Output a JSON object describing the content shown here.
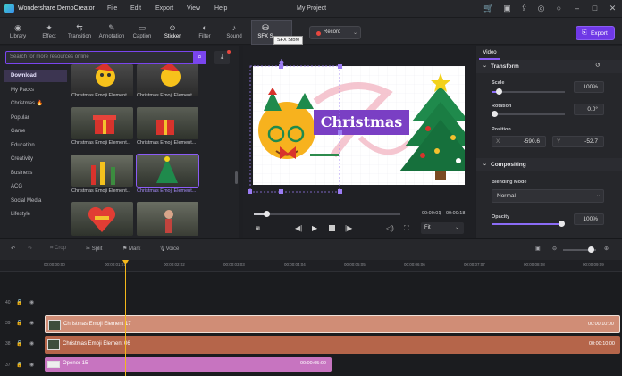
{
  "titlebar": {
    "app_name": "Wondershare DemoCreator",
    "menu": [
      "File",
      "Edit",
      "Export",
      "View",
      "Help"
    ],
    "project_title": "My Project"
  },
  "toolbar": {
    "tools": [
      {
        "label": "Library",
        "icon": "library-icon"
      },
      {
        "label": "Effect",
        "icon": "effect-icon"
      },
      {
        "label": "Transition",
        "icon": "transition-icon"
      },
      {
        "label": "Annotation",
        "icon": "annotation-icon"
      },
      {
        "label": "Caption",
        "icon": "caption-icon"
      },
      {
        "label": "Sticker",
        "icon": "sticker-icon"
      },
      {
        "label": "Filter",
        "icon": "filter-icon"
      },
      {
        "label": "Sound",
        "icon": "sound-icon"
      },
      {
        "label": "SFX S",
        "icon": "sfx-store-icon"
      }
    ],
    "tooltip": "SFX Store",
    "record_label": "Record",
    "export_label": "Export"
  },
  "library": {
    "search_placeholder": "Search for more resources online",
    "categories": [
      "Download",
      "My Packs",
      "Christmas 🔥",
      "Popular",
      "Game",
      "Education",
      "Creativity",
      "Business",
      "ACG",
      "Social Media",
      "Lifestyle"
    ],
    "items": [
      "Christmas Emoji Element...",
      "Christmas Emoji Element...",
      "Christmas Emoji Element...",
      "Christmas Emoji Element...",
      "Christmas Emoji Element...",
      "Christmas Emoji Element..."
    ]
  },
  "preview": {
    "canvas_text": "Christmas",
    "current_time": "00:00:01",
    "total_time": "00:00:18",
    "zoom": "Fit"
  },
  "properties": {
    "tab": "Video",
    "transform_title": "Transform",
    "scale_label": "Scale",
    "scale_value": "100%",
    "scale_fraction": 0.1,
    "rotation_label": "Rotation",
    "rotation_value": "0.0°",
    "position_label": "Position",
    "pos_x_label": "X",
    "pos_x": "-590.6",
    "pos_y_label": "Y",
    "pos_y": "-52.7",
    "compositing_title": "Compositing",
    "blending_label": "Blending Mode",
    "blending_value": "Normal",
    "opacity_label": "Opacity",
    "opacity_value": "100%",
    "opacity_fraction": 1.0
  },
  "timeline": {
    "tools": [
      "Crop",
      "Split",
      "Mark",
      "Voice"
    ],
    "ruler": [
      "00:00:00:00",
      "00:00:01:01",
      "00:00:02:02",
      "00:00:03:03",
      "00:00:04:04",
      "00:00:05:05",
      "00:00:06:06",
      "00:00:07:07",
      "00:00:08:08",
      "00:00:09:09"
    ],
    "tracks": [
      {
        "num": "40",
        "clip": "",
        "time": ""
      },
      {
        "num": "39",
        "clip": "Christmas Emoji Element 17",
        "time": "00:00:10:00"
      },
      {
        "num": "38",
        "clip": "Christmas Emoji Element 06",
        "time": "00:00:10:00"
      },
      {
        "num": "37",
        "clip": "Opener 15",
        "time": "00:00:05:00"
      }
    ]
  }
}
